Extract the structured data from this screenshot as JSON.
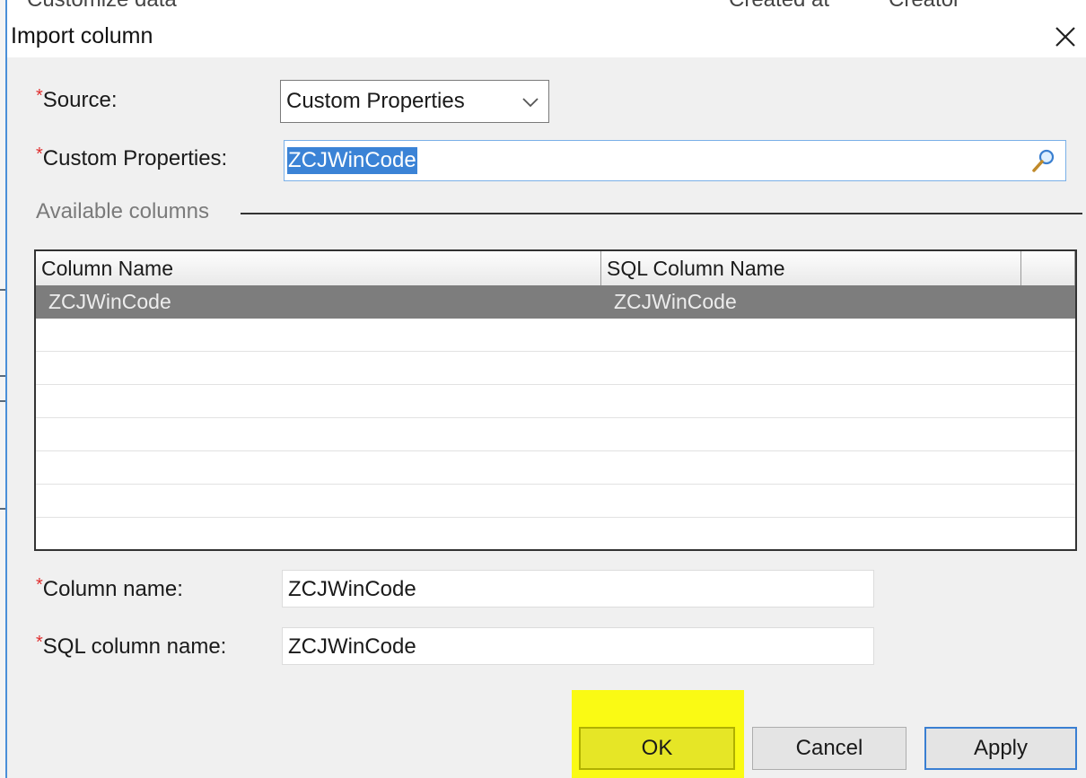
{
  "background_window": {
    "fragments": [
      "Customize data",
      "Created at",
      "Creator"
    ]
  },
  "dialog": {
    "title": "Import column",
    "close_icon": "close-icon"
  },
  "form": {
    "source": {
      "required_mark": "*",
      "label": "Source:",
      "value": "Custom Properties"
    },
    "custom_properties": {
      "required_mark": "*",
      "label": "Custom Properties:",
      "value": "ZCJWinCode",
      "icon": "magnifier-icon"
    },
    "available_columns_label": "Available columns",
    "column_name": {
      "required_mark": "*",
      "label": "Column name:",
      "value": "ZCJWinCode"
    },
    "sql_column_name": {
      "required_mark": "*",
      "label": "SQL column name:",
      "value": "ZCJWinCode"
    }
  },
  "grid": {
    "columns": [
      "Column Name",
      "SQL Column Name",
      ""
    ],
    "rows": [
      {
        "column_name": "ZCJWinCode",
        "sql_column_name": "ZCJWinCode",
        "selected": true
      }
    ],
    "colors": {
      "selected_row": "#7d7d7d"
    }
  },
  "buttons": {
    "ok": "OK",
    "cancel": "Cancel",
    "apply": "Apply"
  },
  "colors": {
    "highlight": "#fafa14",
    "required": "#e03030",
    "selection": "#3b83d6"
  }
}
